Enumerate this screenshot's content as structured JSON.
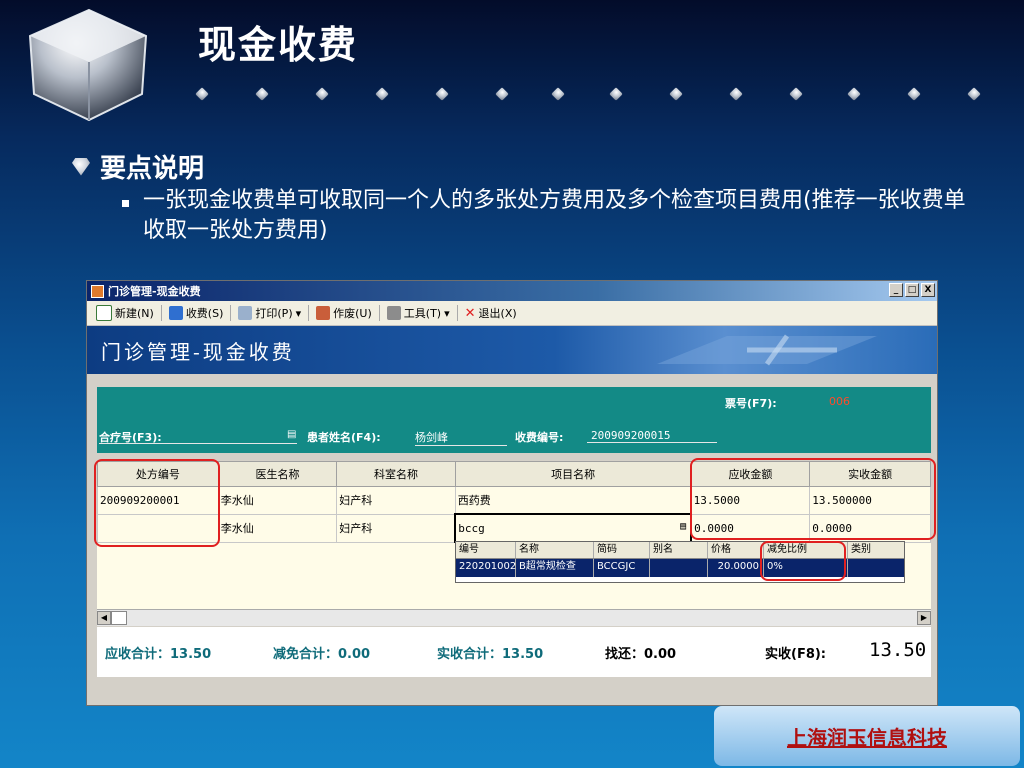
{
  "slide": {
    "title": "现金收费",
    "point_heading": "要点说明",
    "point_text": "一张现金收费单可收取同一个人的多张处方费用及多个检查项目费用(推荐一张收费单收取一张处方费用)",
    "company": "上海润玉信息科技"
  },
  "window": {
    "title": "门诊管理-现金收费",
    "controls": [
      "_",
      "□",
      "X"
    ]
  },
  "toolbar": {
    "new_label": "新建(N)",
    "charge_label": "收费(S)",
    "print_label": "打印(P)",
    "void_label": "作废(U)",
    "tools_label": "工具(T)",
    "exit_label": "退出(X)"
  },
  "banner": {
    "title": "门诊管理-现金收费"
  },
  "form": {
    "ticket_label": "票号(F7):",
    "ticket_value": "006",
    "coop_label": "合疗号(F3):",
    "patient_label": "患者姓名(F4):",
    "patient_value": "杨剑峰",
    "charge_no_label": "收费编号:",
    "charge_no_value": "200909200015"
  },
  "grid": {
    "columns": [
      "处方编号",
      "医生名称",
      "科室名称",
      "项目名称",
      "应收金额",
      "实收金额"
    ],
    "rows": [
      [
        "200909200001",
        "李水仙",
        "妇产科",
        "西药费",
        "13.5000",
        "13.500000"
      ],
      [
        "",
        "李水仙",
        "妇产科",
        "bccg",
        "0.0000",
        "0.0000"
      ]
    ]
  },
  "popup": {
    "columns": [
      "编号",
      "名称",
      "简码",
      "别名",
      "价格",
      "减免比例",
      "类别"
    ],
    "row": [
      "220201002",
      "B超常规检查",
      "BCCGJC",
      "",
      "20.0000",
      "0%",
      ""
    ]
  },
  "summary": {
    "receivable": "应收合计：13.50",
    "discount": "减免合计：0.00",
    "actual": "实收合计：13.50",
    "change": "找还：0.00",
    "paid_label": "实收(F8):",
    "paid_value": "13.50"
  }
}
